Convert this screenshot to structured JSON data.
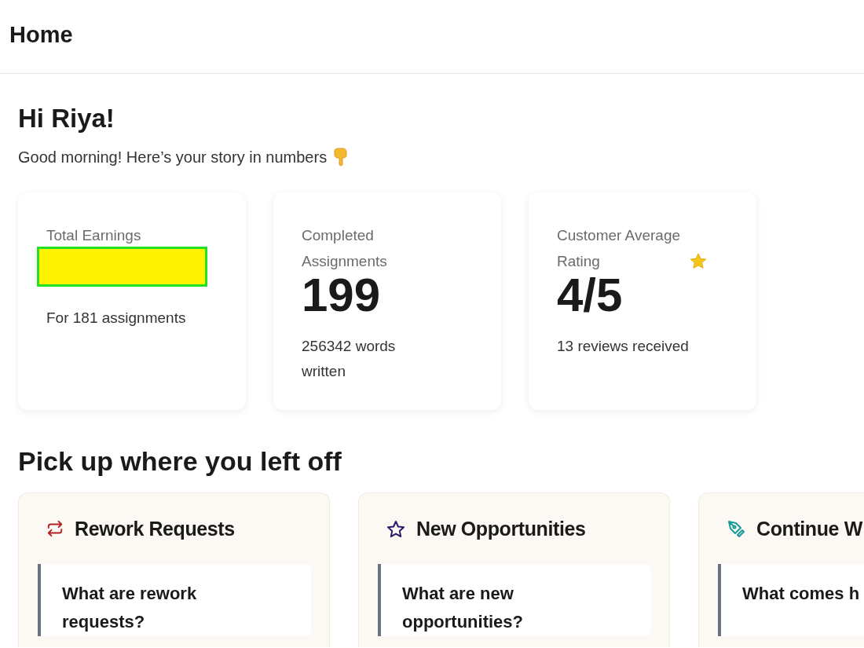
{
  "header": {
    "title": "Home"
  },
  "greeting": {
    "title": "Hi Riya!",
    "subtitle": "Good morning! Here’s your story in numbers"
  },
  "stats": [
    {
      "label": "Total Earnings",
      "kind": "redacted",
      "note": "For 181 assignments"
    },
    {
      "label": "Completed Assignments",
      "kind": "value",
      "value": "199",
      "note": "256342 words written"
    },
    {
      "label": "Customer Average Rating",
      "kind": "rating",
      "value": "4/5",
      "note": "13 reviews received"
    }
  ],
  "section": {
    "title": "Pick up where you left off"
  },
  "cards": [
    {
      "kind": "rework",
      "title": "Rework Requests",
      "question": "What are rework requests?"
    },
    {
      "kind": "new",
      "title": "New Opportunities",
      "question": "What are new opportunities?"
    },
    {
      "kind": "continue",
      "title": "Continue W",
      "question": "What comes h"
    }
  ]
}
